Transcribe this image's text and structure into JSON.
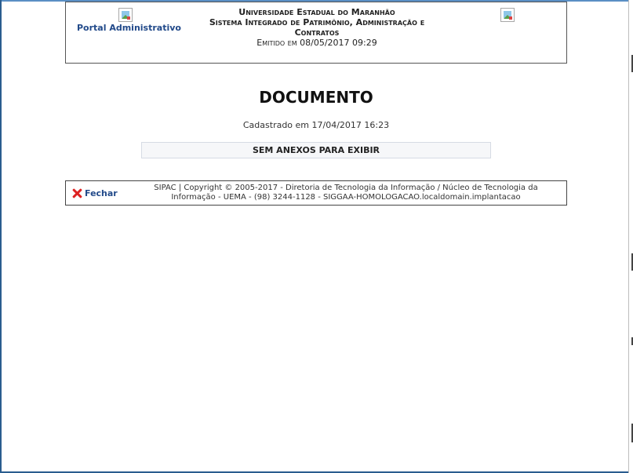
{
  "header": {
    "portal_label": "Portal Administrativo",
    "university": "Universidade Estadual do Maranhão",
    "system_line1": "Sistema Integrado de Patrimônio, Administração e",
    "system_line2": "Contratos",
    "emitted": "Emitido em 08/05/2017 09:29"
  },
  "document": {
    "title": "DOCUMENTO",
    "registered": "Cadastrado em 17/04/2017 16:23",
    "no_attachments": "SEM ANEXOS PARA EXIBIR"
  },
  "footer": {
    "close_label": "Fechar",
    "copyright_line1": "SIPAC | Copyright © 2005-2017 - Diretoria de Tecnologia da Informação / Núcleo de Tecnologia da",
    "copyright_line2": "Informação - UEMA - (98) 3244-1128 - SIGGAA-HOMOLOGACAO.localdomain.implantacao"
  },
  "icons": {
    "close": "close-x-icon",
    "logo_left": "broken-image-icon",
    "logo_right": "broken-image-icon"
  }
}
